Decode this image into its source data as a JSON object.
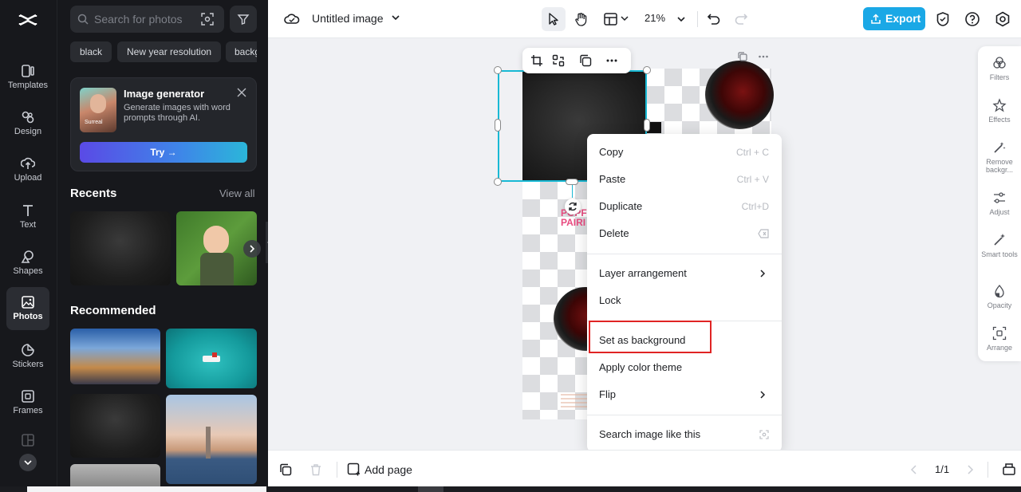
{
  "rail": {
    "items": [
      {
        "label": "Templates",
        "icon": "templates-icon"
      },
      {
        "label": "Design",
        "icon": "design-icon"
      },
      {
        "label": "Upload",
        "icon": "upload-icon"
      },
      {
        "label": "Text",
        "icon": "text-icon"
      },
      {
        "label": "Shapes",
        "icon": "shapes-icon"
      },
      {
        "label": "Photos",
        "icon": "photos-icon",
        "active": true
      },
      {
        "label": "Stickers",
        "icon": "stickers-icon"
      },
      {
        "label": "Frames",
        "icon": "frames-icon"
      }
    ]
  },
  "panel": {
    "search": {
      "placeholder": "Search for photos"
    },
    "chips": [
      "black",
      "New year resolution",
      "backg"
    ],
    "generator": {
      "title": "Image generator",
      "description": "Generate images with word prompts through AI.",
      "thumb_label": "Surreal",
      "try_label": "Try →"
    },
    "recents": {
      "title": "Recents",
      "view_all": "View all"
    },
    "recommended": {
      "title": "Recommended"
    }
  },
  "topbar": {
    "doc_title": "Untitled image",
    "zoom": "21%",
    "export_label": "Export"
  },
  "context_menu": {
    "copy": {
      "label": "Copy",
      "shortcut": "Ctrl + C"
    },
    "paste": {
      "label": "Paste",
      "shortcut": "Ctrl + V"
    },
    "duplicate": {
      "label": "Duplicate",
      "shortcut": "Ctrl+D"
    },
    "delete": {
      "label": "Delete"
    },
    "layer": {
      "label": "Layer arrangement"
    },
    "lock": {
      "label": "Lock"
    },
    "set_bg": {
      "label": "Set as background"
    },
    "color_theme": {
      "label": "Apply color theme"
    },
    "flip": {
      "label": "Flip"
    },
    "search_like": {
      "label": "Search image like this"
    }
  },
  "canvas": {
    "pink_text": [
      "POPF",
      "PAIRI"
    ]
  },
  "tools": [
    {
      "label": "Filters",
      "icon": "filters-icon"
    },
    {
      "label": "Effects",
      "icon": "effects-icon"
    },
    {
      "label": "Remove backgr...",
      "icon": "remove-background-icon"
    },
    {
      "label": "Adjust",
      "icon": "adjust-icon"
    },
    {
      "label": "Smart tools",
      "icon": "smart-tools-icon"
    },
    {
      "label": "Opacity",
      "icon": "opacity-icon"
    },
    {
      "label": "Arrange",
      "icon": "arrange-icon"
    }
  ],
  "bottombar": {
    "add_page": "Add page",
    "pager": "1/1"
  },
  "colors": {
    "accent": "#1aa8e6",
    "selection": "#18b9d4",
    "highlight": "#e02424",
    "dark_ui": "#17181c"
  }
}
